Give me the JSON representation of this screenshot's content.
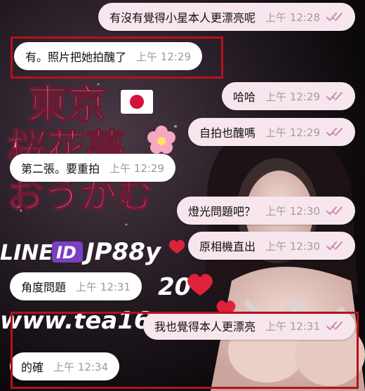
{
  "background": {
    "poster_title_line1": "東京",
    "poster_title_line2": "桜花夢",
    "poster_title_line3": "おうかむ",
    "poster_line_id": "LINE",
    "poster_id_badge": "ID",
    "poster_line_handle": "JP88y",
    "poster_number_fragment": "20",
    "poster_url_fragment": "www.tea16"
  },
  "colors": {
    "outgoing_bubble": "#f7e6ed",
    "incoming_bubble": "#ffffff",
    "read_ticks": "#c88aa8",
    "highlight_box": "#b5121b"
  },
  "messages": [
    {
      "dir": "out",
      "text": "有沒有覺得小星本人更漂亮呢",
      "time": "上午 12:28",
      "read": true
    },
    {
      "dir": "in",
      "text": "有。照片把她拍醜了",
      "time": "上午 12:29"
    },
    {
      "dir": "out",
      "text": "哈哈",
      "time": "上午 12:29",
      "read": true
    },
    {
      "dir": "out",
      "text": "自拍也醜嗎",
      "time": "上午 12:29",
      "read": true
    },
    {
      "dir": "in",
      "text": "第二張。要重拍",
      "time": "上午 12:29"
    },
    {
      "dir": "out",
      "text": "燈光問題吧？",
      "time": "上午 12:30",
      "read": true
    },
    {
      "dir": "out",
      "text": "原相機直出",
      "time": "上午 12:30",
      "read": true
    },
    {
      "dir": "in",
      "text": "角度問題",
      "time": "上午 12:31"
    },
    {
      "dir": "out",
      "text": "我也覺得本人更漂亮",
      "time": "上午 12:31",
      "read": true
    },
    {
      "dir": "in",
      "text": "的確",
      "time": "上午 12:34"
    }
  ]
}
